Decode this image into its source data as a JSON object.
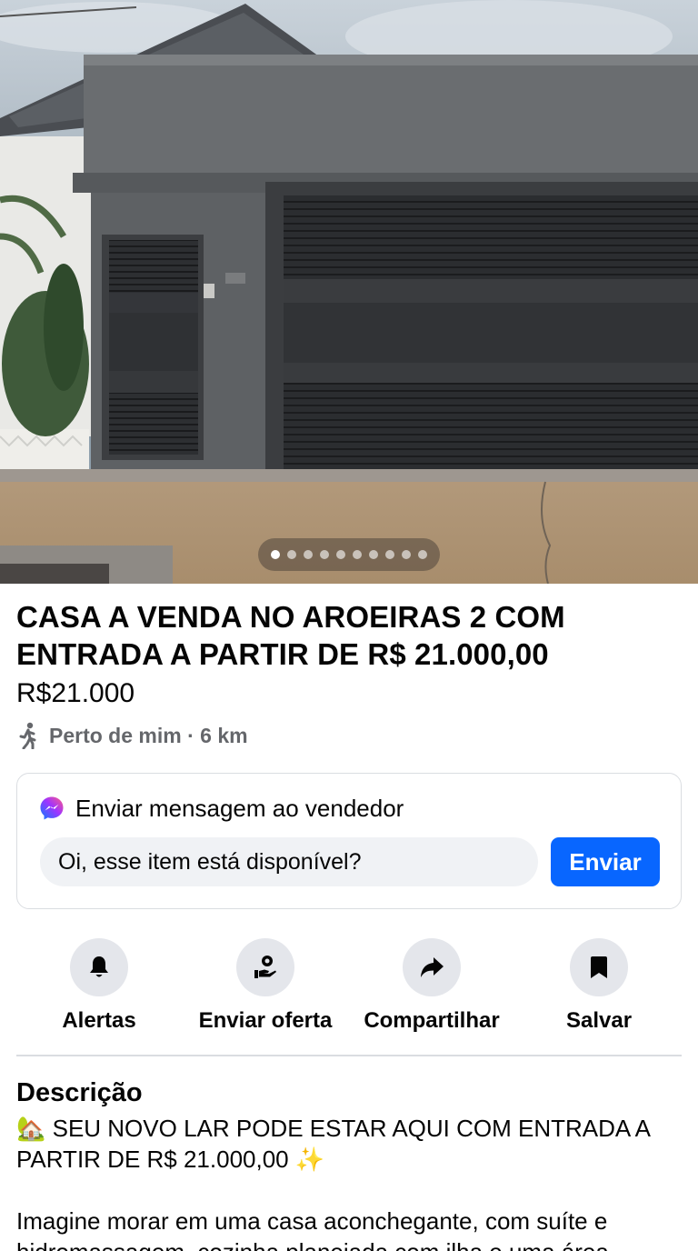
{
  "gallery": {
    "image_alt": "Casa cinza com portão de garagem preto",
    "total_images": 10,
    "active_index": 0
  },
  "listing": {
    "title": "CASA A VENDA NO AROEIRAS 2 COM ENTRADA A PARTIR DE R$ 21.000,00",
    "price": "R$21.000",
    "location": "Perto de mim · 6 km"
  },
  "message": {
    "header": "Enviar mensagem ao vendedor",
    "input_value": "Oi, esse item está disponível?",
    "send_label": "Enviar"
  },
  "actions": [
    {
      "label": "Alertas",
      "icon": "bell-icon"
    },
    {
      "label": "Enviar oferta",
      "icon": "offer-hand-icon"
    },
    {
      "label": "Compartilhar",
      "icon": "share-arrow-icon"
    },
    {
      "label": "Salvar",
      "icon": "bookmark-icon"
    }
  ],
  "description": {
    "heading": "Descrição",
    "body": "🏡 SEU NOVO LAR PODE ESTAR AQUI COM ENTRADA A PARTIR DE R$ 21.000,00 ✨\n\nImagine morar em uma casa aconchegante, com suíte e hidromassagem, cozinha planejada com ilha e uma área"
  },
  "colors": {
    "accent": "#0866ff",
    "secondary_text": "#65676b",
    "icon_circle": "#e4e6eb",
    "input_bg": "#f0f2f5"
  }
}
